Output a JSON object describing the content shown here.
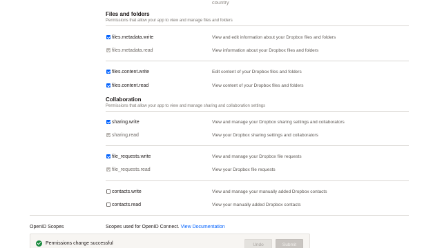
{
  "top_fragment": "country",
  "sections": [
    {
      "title": "Files and folders",
      "description": "Permissions that allow your app to view and manage files and folders",
      "scopes": [
        {
          "name": "files.metadata.write",
          "desc": "View and edit information about your Dropbox files and folders",
          "checked": true,
          "disabled": false
        },
        {
          "name": "files.metadata.read",
          "desc": "View information about your Dropbox files and folders",
          "checked": true,
          "disabled": true
        },
        {
          "name": "files.content.write",
          "desc": "Edit content of your Dropbox files and folders",
          "checked": true,
          "disabled": false
        },
        {
          "name": "files.content.read",
          "desc": "View content of your Dropbox files and folders",
          "checked": true,
          "disabled": false
        }
      ]
    },
    {
      "title": "Collaboration",
      "description": "Permissions that allow your app to view and manage sharing and collaboration settings",
      "scopes": [
        {
          "name": "sharing.write",
          "desc": "View and manage your Dropbox sharing settings and collaborators",
          "checked": true,
          "disabled": false
        },
        {
          "name": "sharing.read",
          "desc": "View your Dropbox sharing settings and collaborators",
          "checked": true,
          "disabled": true
        },
        {
          "name": "file_requests.write",
          "desc": "View and manage your Dropbox file requests",
          "checked": true,
          "disabled": false
        },
        {
          "name": "file_requests.read",
          "desc": "View your Dropbox file requests",
          "checked": true,
          "disabled": true
        },
        {
          "name": "contacts.write",
          "desc": "View and manage your manually added Dropbox contacts",
          "checked": false,
          "disabled": false
        },
        {
          "name": "contacts.read",
          "desc": "View your manually added Dropbox contacts",
          "checked": false,
          "disabled": false
        }
      ]
    }
  ],
  "openid": {
    "label": "OpenID Scopes",
    "text": "Scopes used for OpenID Connect.",
    "link": "View Documentation"
  },
  "toast": {
    "message": "Permissions change successful",
    "undo_label": "Undo",
    "submit_label": "Submit"
  },
  "colors": {
    "accent": "#0061fe",
    "success": "#1a8a3e"
  },
  "icons": {
    "toast": "check-circle-icon",
    "checkbox": "checkbox-icon"
  }
}
